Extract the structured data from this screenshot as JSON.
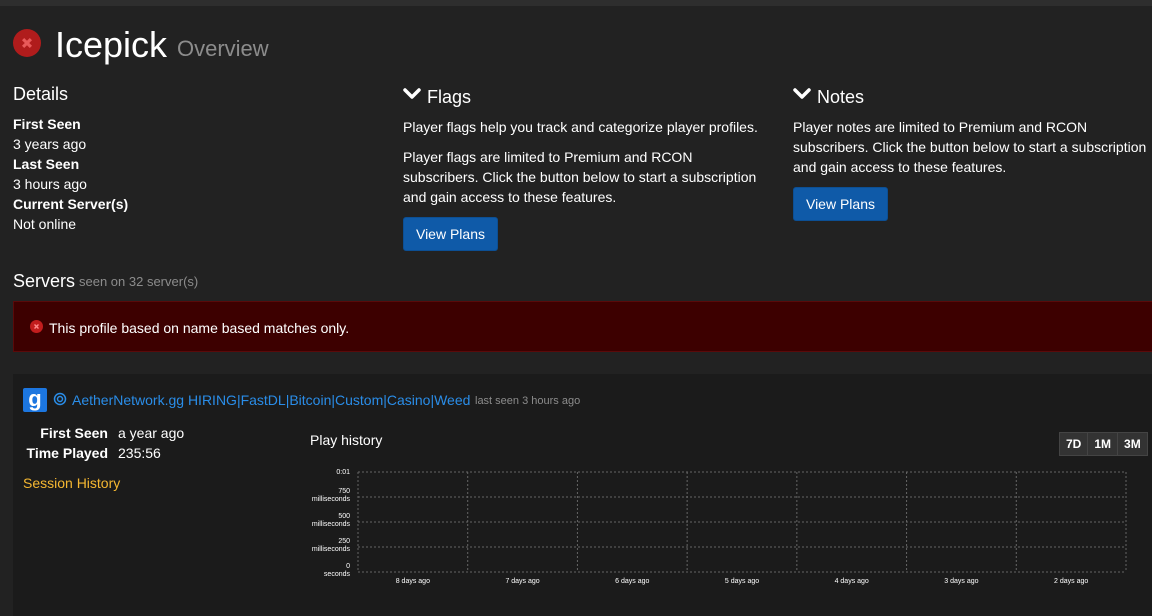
{
  "profile": {
    "name": "Icepick",
    "subtitle": "Overview",
    "status_color": "#b01c1c"
  },
  "details": {
    "heading": "Details",
    "first_seen_label": "First Seen",
    "first_seen_value": "3 years ago",
    "last_seen_label": "Last Seen",
    "last_seen_value": "3 hours ago",
    "current_servers_label": "Current Server(s)",
    "current_servers_value": "Not online"
  },
  "flags": {
    "heading": "Flags",
    "text1": "Player flags help you track and categorize player profiles.",
    "text2_line1": "Player flags are limited to Premium and RCON",
    "text2_line2": "subscribers. Click the button below to start a subscription",
    "text2_line3": "and gain access to these features.",
    "button": "View Plans"
  },
  "notes": {
    "heading": "Notes",
    "text_line1": "Player notes are limited to Premium and RCON",
    "text_line2": "subscribers. Click the button below to start a subscription",
    "text_line3": "and gain access to these features.",
    "button": "View Plans"
  },
  "servers": {
    "heading": "Servers",
    "subheading": "seen on 32 server(s)",
    "alert": "This profile based on name based matches only."
  },
  "server_entry": {
    "game_icon": "g",
    "name": "AetherNetwork.gg HIRING|FastDL|Bitcoin|Custom|Casino|Weed",
    "last_seen": "last seen 3 hours ago",
    "first_seen_label": "First Seen",
    "first_seen_value": "a year ago",
    "time_played_label": "Time Played",
    "time_played_value": "235:56",
    "session_history": "Session History",
    "play_history_title": "Play history",
    "ranges": [
      "7D",
      "1M",
      "3M"
    ]
  },
  "chart_data": {
    "type": "bar",
    "title": "Play history",
    "categories": [
      "8 days ago",
      "7 days ago",
      "6 days ago",
      "5 days ago",
      "4 days ago",
      "3 days ago",
      "2 days ago"
    ],
    "values": [
      0,
      0,
      0,
      0,
      0,
      0,
      0
    ],
    "y_ticks": [
      {
        "v": 1000,
        "l1": "0:01",
        "l2": ""
      },
      {
        "v": 750,
        "l1": "750",
        "l2": "milliseconds"
      },
      {
        "v": 500,
        "l1": "500",
        "l2": "milliseconds"
      },
      {
        "v": 250,
        "l1": "250",
        "l2": "milliseconds"
      },
      {
        "v": 0,
        "l1": "0",
        "l2": "seconds"
      }
    ],
    "ylim": [
      0,
      1000
    ],
    "grid": true
  }
}
